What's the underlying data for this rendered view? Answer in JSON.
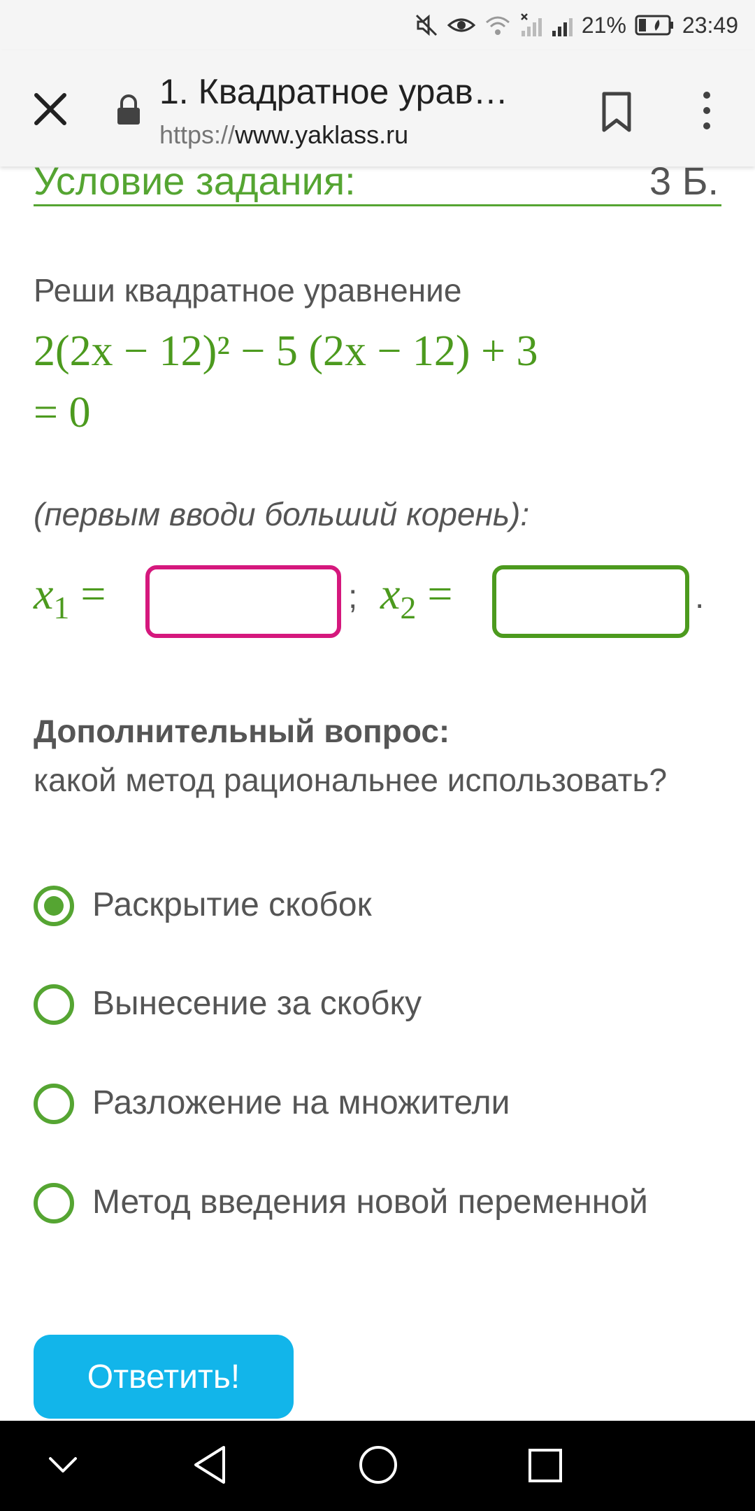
{
  "status_bar": {
    "battery_percent": "21%",
    "time": "23:49"
  },
  "toolbar": {
    "title": "1. Квадратное урав…",
    "url_scheme": "https://",
    "url_host": "www.yaklass.ru"
  },
  "task": {
    "header": "Условие задания:",
    "points": "3 Б.",
    "instruction": "Реши квадратное уравнение",
    "equation_line1": "2(2x − 12)² − 5 (2x − 12) + 3",
    "equation_line2": "= 0",
    "hint": "(первым вводи больший корень):",
    "x1_label": "x",
    "x1_sub": "1",
    "x2_label": "x",
    "x2_sub": "2",
    "equals": "=",
    "separator": ";",
    "end_dot": ".",
    "x1_value": "",
    "x2_value": ""
  },
  "extra": {
    "title": "Дополнительный вопрос:",
    "question": "какой метод рациональнее использовать?",
    "options": [
      {
        "label": "Раскрытие скобок",
        "checked": true
      },
      {
        "label": "Вынесение за скобку",
        "checked": false
      },
      {
        "label": "Разложение на множители",
        "checked": false
      },
      {
        "label": "Метод введения новой переменной",
        "checked": false
      }
    ]
  },
  "submit_label": "Ответить!",
  "colors": {
    "accent_green": "#55a532",
    "math_green": "#4c9a1e",
    "input1_border": "#d5187d",
    "button_blue": "#12b5ea"
  },
  "icons": {
    "status": [
      "mute-icon",
      "eye-icon",
      "wifi-icon",
      "signal-off-icon",
      "signal-icon",
      "battery-icon"
    ],
    "toolbar": [
      "close-icon",
      "lock-icon",
      "bookmark-icon",
      "more-vert-icon"
    ],
    "nav": [
      "chevron-down-icon",
      "back-triangle-icon",
      "home-circle-icon",
      "recents-square-icon"
    ]
  }
}
